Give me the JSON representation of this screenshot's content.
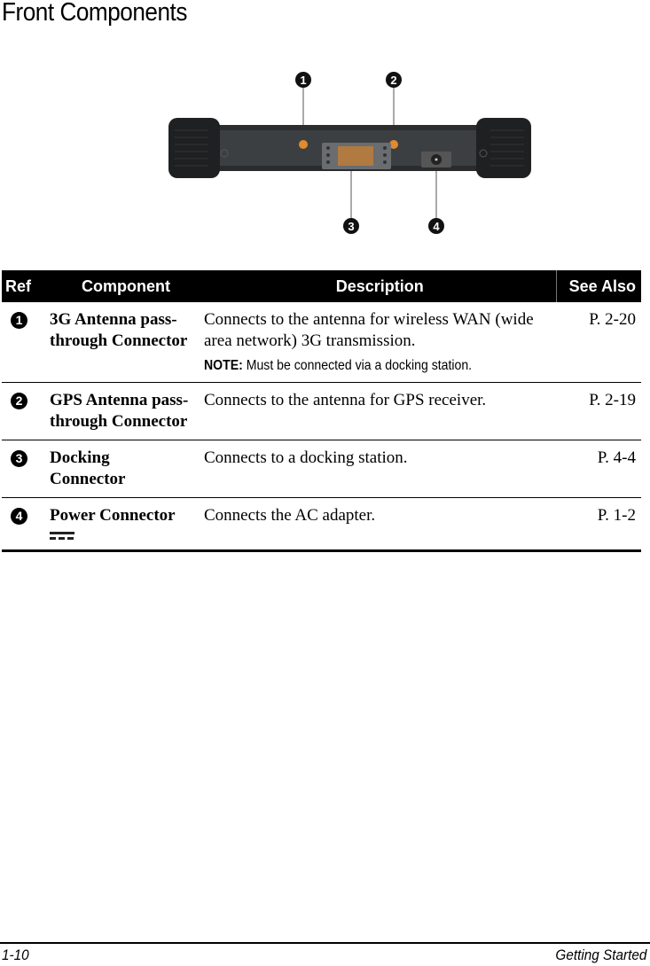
{
  "page": {
    "title": "Front Components"
  },
  "figure": {
    "callouts": [
      "1",
      "2",
      "3",
      "4"
    ],
    "description": "Front edge view of rugged tablet with numbered callouts"
  },
  "table": {
    "headers": {
      "ref": "Ref",
      "component": "Component",
      "description": "Description",
      "see_also": "See Also"
    },
    "rows": [
      {
        "ref": "1",
        "component": "3G Antenna pass-through Connector",
        "description": "Connects to the antenna for wireless WAN (wide area network) 3G transmission.",
        "note_label": "NOTE:",
        "note_text": " Must be connected via a docking station.",
        "see_also": "P. 2-20"
      },
      {
        "ref": "2",
        "component": "GPS Antenna pass-through Connector",
        "description": "Connects to the antenna for GPS receiver.",
        "see_also": "P. 2-19"
      },
      {
        "ref": "3",
        "component": "Docking Connector",
        "description": "Connects to a docking station.",
        "see_also": "P. 4-4"
      },
      {
        "ref": "4",
        "component": "Power Connector",
        "component_icon": "dc-power-icon",
        "description": "Connects the AC adapter.",
        "see_also": "P. 1-2"
      }
    ]
  },
  "footer": {
    "page_number": "1-10",
    "section": "Getting Started"
  }
}
